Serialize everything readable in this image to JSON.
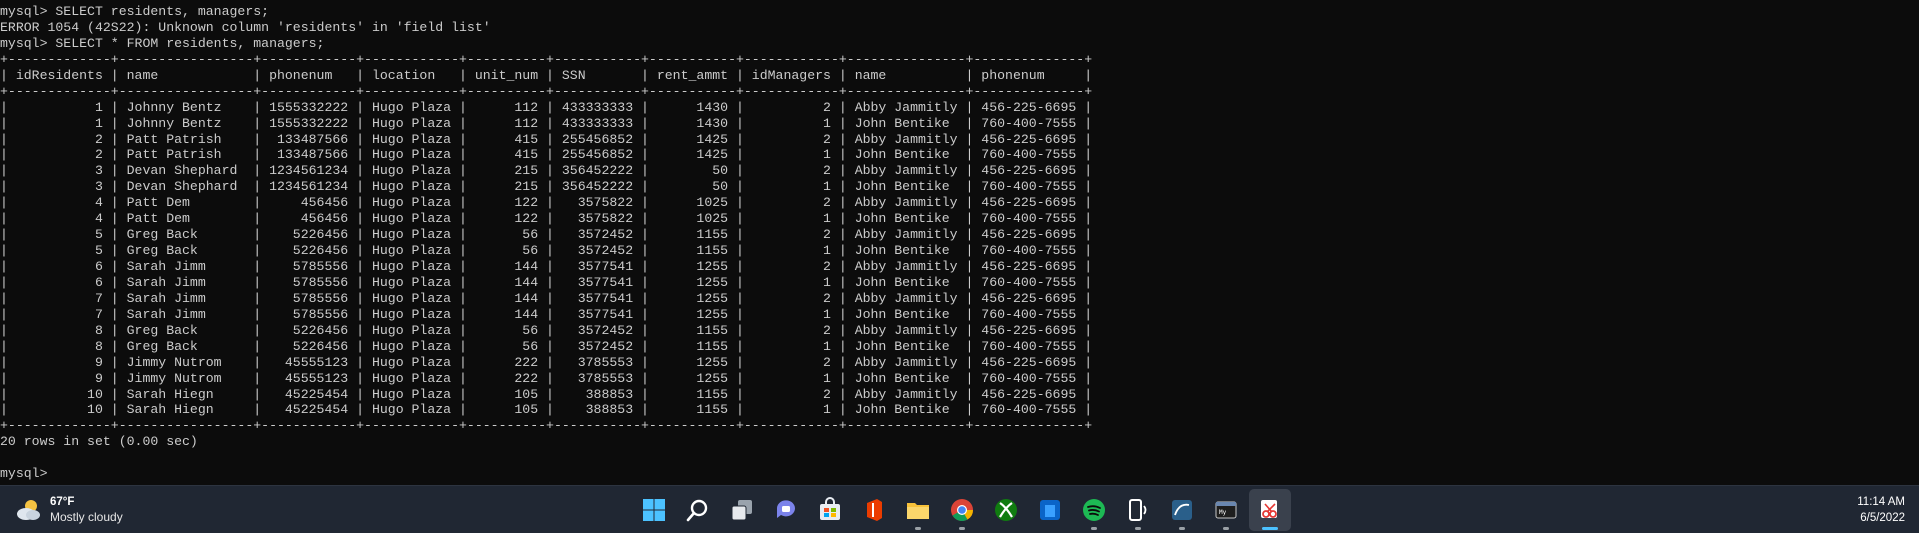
{
  "terminal": {
    "lines": [
      "mysql> SELECT residents, managers;",
      "ERROR 1054 (42S22): Unknown column 'residents' in 'field list'",
      "mysql> SELECT * FROM residents, managers;",
      "+-------------+-----------------+------------+------------+----------+-----------+-----------+------------+---------------+--------------+",
      "| idResidents | name            | phonenum   | location   | unit_num | SSN       | rent_ammt | idManagers | name          | phonenum     |",
      "+-------------+-----------------+------------+------------+----------+-----------+-----------+------------+---------------+--------------+",
      "|           1 | Johnny Bentz    | 1555332222 | Hugo Plaza |      112 | 433333333 |      1430 |          2 | Abby Jammitly | 456-225-6695 |",
      "|           1 | Johnny Bentz    | 1555332222 | Hugo Plaza |      112 | 433333333 |      1430 |          1 | John Bentike  | 760-400-7555 |",
      "|           2 | Patt Patrish    |  133487566 | Hugo Plaza |      415 | 255456852 |      1425 |          2 | Abby Jammitly | 456-225-6695 |",
      "|           2 | Patt Patrish    |  133487566 | Hugo Plaza |      415 | 255456852 |      1425 |          1 | John Bentike  | 760-400-7555 |",
      "|           3 | Devan Shephard  | 1234561234 | Hugo Plaza |      215 | 356452222 |        50 |          2 | Abby Jammitly | 456-225-6695 |",
      "|           3 | Devan Shephard  | 1234561234 | Hugo Plaza |      215 | 356452222 |        50 |          1 | John Bentike  | 760-400-7555 |",
      "|           4 | Patt Dem        |     456456 | Hugo Plaza |      122 |   3575822 |      1025 |          2 | Abby Jammitly | 456-225-6695 |",
      "|           4 | Patt Dem        |     456456 | Hugo Plaza |      122 |   3575822 |      1025 |          1 | John Bentike  | 760-400-7555 |",
      "|           5 | Greg Back       |    5226456 | Hugo Plaza |       56 |   3572452 |      1155 |          2 | Abby Jammitly | 456-225-6695 |",
      "|           5 | Greg Back       |    5226456 | Hugo Plaza |       56 |   3572452 |      1155 |          1 | John Bentike  | 760-400-7555 |",
      "|           6 | Sarah Jimm      |    5785556 | Hugo Plaza |      144 |   3577541 |      1255 |          2 | Abby Jammitly | 456-225-6695 |",
      "|           6 | Sarah Jimm      |    5785556 | Hugo Plaza |      144 |   3577541 |      1255 |          1 | John Bentike  | 760-400-7555 |",
      "|           7 | Sarah Jimm      |    5785556 | Hugo Plaza |      144 |   3577541 |      1255 |          2 | Abby Jammitly | 456-225-6695 |",
      "|           7 | Sarah Jimm      |    5785556 | Hugo Plaza |      144 |   3577541 |      1255 |          1 | John Bentike  | 760-400-7555 |",
      "|           8 | Greg Back       |    5226456 | Hugo Plaza |       56 |   3572452 |      1155 |          2 | Abby Jammitly | 456-225-6695 |",
      "|           8 | Greg Back       |    5226456 | Hugo Plaza |       56 |   3572452 |      1155 |          1 | John Bentike  | 760-400-7555 |",
      "|           9 | Jimmy Nutrom    |   45555123 | Hugo Plaza |      222 |   3785553 |      1255 |          2 | Abby Jammitly | 456-225-6695 |",
      "|           9 | Jimmy Nutrom    |   45555123 | Hugo Plaza |      222 |   3785553 |      1255 |          1 | John Bentike  | 760-400-7555 |",
      "|          10 | Sarah Hiegn     |   45225454 | Hugo Plaza |      105 |    388853 |      1155 |          2 | Abby Jammitly | 456-225-6695 |",
      "|          10 | Sarah Hiegn     |   45225454 | Hugo Plaza |      105 |    388853 |      1155 |          1 | John Bentike  | 760-400-7555 |",
      "+-------------+-----------------+------------+------------+----------+-----------+-----------+------------+---------------+--------------+",
      "20 rows in set (0.00 sec)",
      "",
      "mysql> "
    ]
  },
  "taskbar": {
    "weather": {
      "temperature": "67°F",
      "condition": "Mostly cloudy",
      "icon": "partly-cloudy-icon"
    },
    "apps": [
      {
        "name": "start",
        "icon": "windows-logo-icon",
        "running": false,
        "active": false
      },
      {
        "name": "search",
        "icon": "search-icon",
        "running": false,
        "active": false
      },
      {
        "name": "task-view",
        "icon": "task-view-icon",
        "running": false,
        "active": false
      },
      {
        "name": "chat",
        "icon": "teams-chat-icon",
        "running": false,
        "active": false
      },
      {
        "name": "store",
        "icon": "store-icon",
        "running": false,
        "active": false
      },
      {
        "name": "office",
        "icon": "office-icon",
        "running": false,
        "active": false
      },
      {
        "name": "file-explorer",
        "icon": "folder-icon",
        "running": true,
        "active": false
      },
      {
        "name": "chrome",
        "icon": "chrome-icon",
        "running": true,
        "active": false
      },
      {
        "name": "xbox",
        "icon": "xbox-icon",
        "running": false,
        "active": false
      },
      {
        "name": "app-blue",
        "icon": "blue-app-icon",
        "running": false,
        "active": false
      },
      {
        "name": "spotify",
        "icon": "spotify-icon",
        "running": true,
        "active": false
      },
      {
        "name": "phone-link",
        "icon": "phone-link-icon",
        "running": true,
        "active": false
      },
      {
        "name": "mysql-workbench",
        "icon": "mysql-workbench-icon",
        "running": true,
        "active": false
      },
      {
        "name": "mysql-shell",
        "icon": "mysql-shell-icon",
        "running": true,
        "active": false
      },
      {
        "name": "snipping-tool",
        "icon": "snipping-tool-icon",
        "running": true,
        "active": true
      }
    ],
    "clock": {
      "time": "11:14 AM",
      "date": "6/5/2022"
    }
  }
}
